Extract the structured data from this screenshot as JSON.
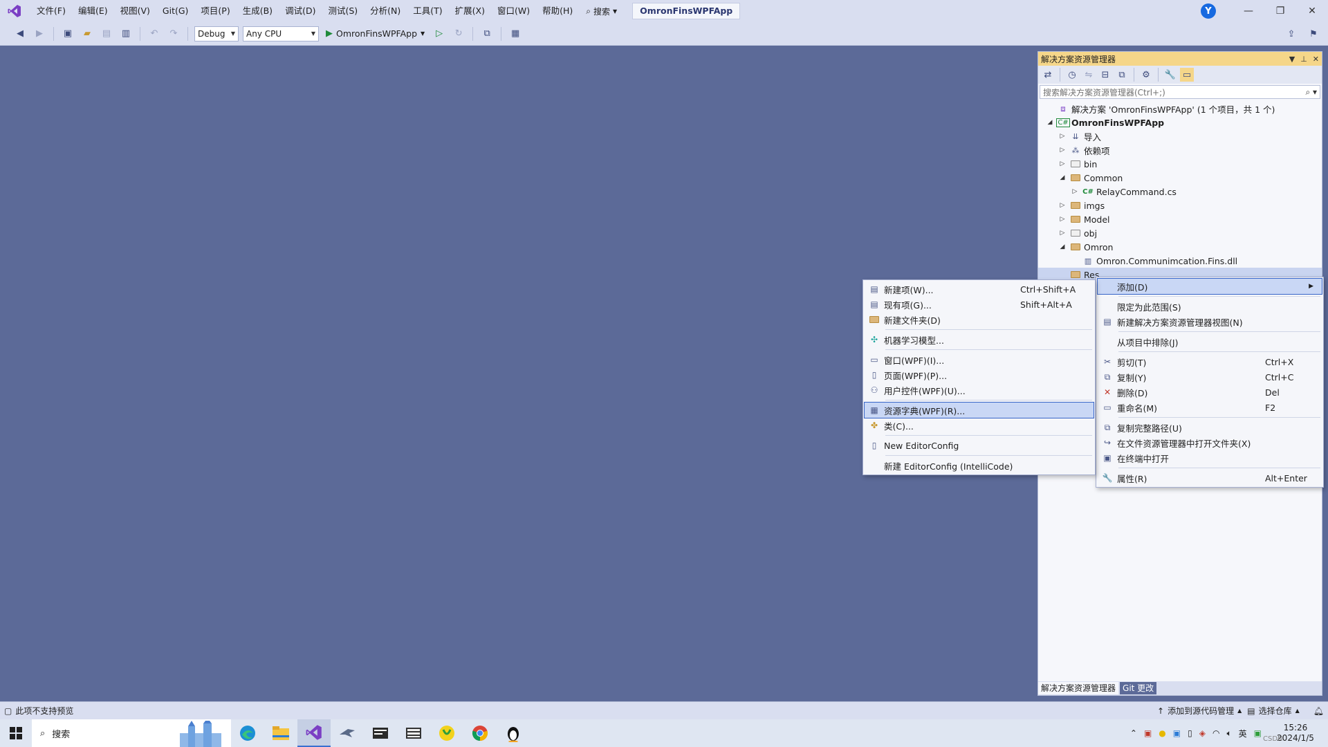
{
  "menu": {
    "items": [
      "文件(F)",
      "编辑(E)",
      "视图(V)",
      "Git(G)",
      "项目(P)",
      "生成(B)",
      "调试(D)",
      "测试(S)",
      "分析(N)",
      "工具(T)",
      "扩展(X)",
      "窗口(W)",
      "帮助(H)"
    ],
    "search_label": "搜索",
    "solution_name": "OmronFinsWPFApp",
    "avatar_letter": "Y"
  },
  "toolbar": {
    "config": "Debug",
    "platform": "Any CPU",
    "run_target": "OmronFinsWPFApp"
  },
  "solution_explorer": {
    "title": "解决方案资源管理器",
    "search_placeholder": "搜索解决方案资源管理器(Ctrl+;)",
    "tree": [
      {
        "label": "解决方案 'OmronFinsWPFApp' (1 个项目，共 1 个)",
        "level": 0,
        "arrow": "",
        "icon": "solution"
      },
      {
        "label": "OmronFinsWPFApp",
        "level": 0,
        "arrow": "expanded",
        "icon": "project",
        "bold": true
      },
      {
        "label": "导入",
        "level": 1,
        "arrow": "collapsed",
        "icon": "import"
      },
      {
        "label": "依赖项",
        "level": 1,
        "arrow": "collapsed",
        "icon": "deps"
      },
      {
        "label": "bin",
        "level": 1,
        "arrow": "collapsed",
        "icon": "folder-gray"
      },
      {
        "label": "Common",
        "level": 1,
        "arrow": "expanded",
        "icon": "folder"
      },
      {
        "label": "RelayCommand.cs",
        "level": 2,
        "arrow": "collapsed",
        "icon": "csharp"
      },
      {
        "label": "imgs",
        "level": 1,
        "arrow": "collapsed",
        "icon": "folder"
      },
      {
        "label": "Model",
        "level": 1,
        "arrow": "collapsed",
        "icon": "folder"
      },
      {
        "label": "obj",
        "level": 1,
        "arrow": "collapsed",
        "icon": "folder-gray"
      },
      {
        "label": "Omron",
        "level": 1,
        "arrow": "expanded",
        "icon": "folder"
      },
      {
        "label": "Omron.Communimcation.Fins.dll",
        "level": 2,
        "arrow": "",
        "icon": "dll"
      },
      {
        "label": "Res",
        "level": 1,
        "arrow": "",
        "icon": "folder",
        "selected": true
      }
    ],
    "tabs": [
      "解决方案资源管理器",
      "Git 更改"
    ]
  },
  "context_menu": {
    "items": [
      {
        "label": "添加(D)",
        "shortcut": "",
        "icon": "",
        "submenu": true,
        "highlight": true
      },
      {
        "sep": true
      },
      {
        "label": "限定为此范围(S)",
        "shortcut": "",
        "icon": ""
      },
      {
        "label": "新建解决方案资源管理器视图(N)",
        "shortcut": "",
        "icon": "view"
      },
      {
        "sep": true
      },
      {
        "label": "从项目中排除(J)",
        "shortcut": "",
        "icon": ""
      },
      {
        "sep": true
      },
      {
        "label": "剪切(T)",
        "shortcut": "Ctrl+X",
        "icon": "cut"
      },
      {
        "label": "复制(Y)",
        "shortcut": "Ctrl+C",
        "icon": "copy"
      },
      {
        "label": "删除(D)",
        "shortcut": "Del",
        "icon": "delete"
      },
      {
        "label": "重命名(M)",
        "shortcut": "F2",
        "icon": "rename"
      },
      {
        "sep": true
      },
      {
        "label": "复制完整路径(U)",
        "shortcut": "",
        "icon": "copy"
      },
      {
        "label": "在文件资源管理器中打开文件夹(X)",
        "shortcut": "",
        "icon": "open"
      },
      {
        "label": "在终端中打开",
        "shortcut": "",
        "icon": "terminal"
      },
      {
        "sep": true
      },
      {
        "label": "属性(R)",
        "shortcut": "Alt+Enter",
        "icon": "wrench"
      }
    ]
  },
  "add_submenu": {
    "items": [
      {
        "label": "新建项(W)...",
        "shortcut": "Ctrl+Shift+A",
        "icon": "newitem"
      },
      {
        "label": "现有项(G)...",
        "shortcut": "Shift+Alt+A",
        "icon": "existing"
      },
      {
        "label": "新建文件夹(D)",
        "shortcut": "",
        "icon": "folder"
      },
      {
        "sep": true
      },
      {
        "label": "机器学习模型...",
        "shortcut": "",
        "icon": "ml"
      },
      {
        "sep": true
      },
      {
        "label": "窗口(WPF)(I)...",
        "shortcut": "",
        "icon": "window"
      },
      {
        "label": "页面(WPF)(P)...",
        "shortcut": "",
        "icon": "page"
      },
      {
        "label": "用户控件(WPF)(U)...",
        "shortcut": "",
        "icon": "usercontrol"
      },
      {
        "sep": true
      },
      {
        "label": "资源字典(WPF)(R)...",
        "shortcut": "",
        "icon": "resdict",
        "highlight": true
      },
      {
        "label": "类(C)...",
        "shortcut": "",
        "icon": "class"
      },
      {
        "sep": true
      },
      {
        "label": "New EditorConfig",
        "shortcut": "",
        "icon": "file"
      },
      {
        "sep": true
      },
      {
        "label": "新建 EditorConfig (IntelliCode)",
        "shortcut": "",
        "icon": ""
      }
    ]
  },
  "statusbar": {
    "left": "此项不支持预览",
    "source_control": "添加到源代码管理",
    "repo": "选择仓库"
  },
  "taskbar": {
    "search_label": "搜索",
    "time": "15:26",
    "date": "2024/1/5",
    "ime": "英",
    "watermark": "CSDN"
  },
  "colors": {
    "accent": "#5c6a98",
    "chrome": "#d9def0",
    "header": "#f5d689",
    "highlight": "#c9d7f5"
  }
}
